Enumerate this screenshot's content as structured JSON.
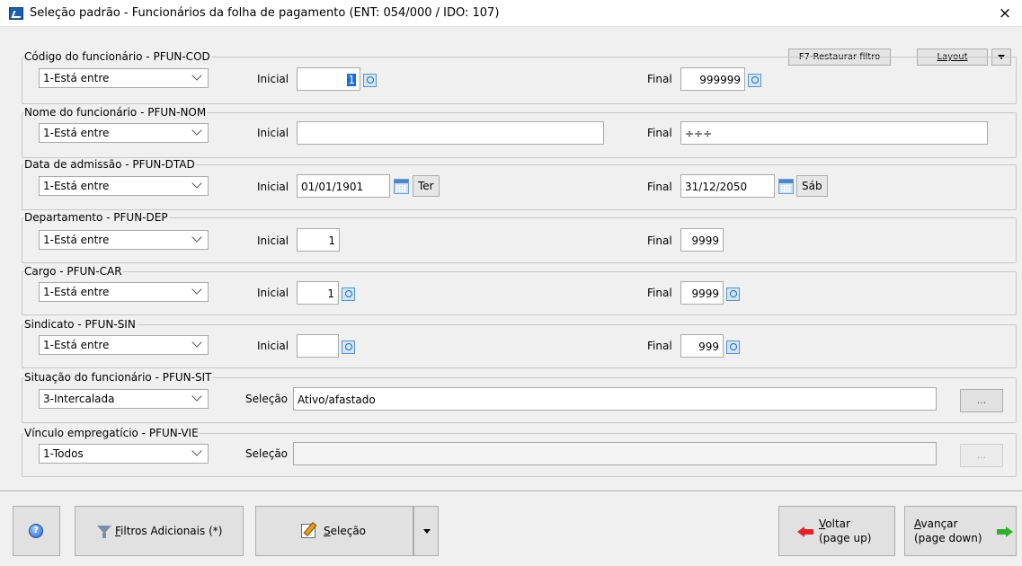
{
  "window": {
    "title": "Seleção padrão - Funcionários da folha de pagamento (ENT: 054/000 / IDO: 107)",
    "close": "×"
  },
  "toolbar": {
    "restore_filter": "F7-Restaurar filtro",
    "layout": "Layout"
  },
  "labels": {
    "initial": "Inicial",
    "final": "Final",
    "selection": "Seleção"
  },
  "groups": [
    {
      "title": "Código do funcionário - PFUN-COD",
      "operator": "1-Está entre",
      "initial": "1",
      "final": "999999"
    },
    {
      "title": "Nome do funcionário - PFUN-NOM",
      "operator": "1-Está entre",
      "initial": "",
      "final": "÷÷÷"
    },
    {
      "title": "Data de admissão - PFUN-DTAD",
      "operator": "1-Está entre",
      "initial": "01/01/1901",
      "initial_day": "Ter",
      "final": "31/12/2050",
      "final_day": "Sáb"
    },
    {
      "title": "Departamento - PFUN-DEP",
      "operator": "1-Está entre",
      "initial": "1",
      "final": "9999"
    },
    {
      "title": "Cargo - PFUN-CAR",
      "operator": "1-Está entre",
      "initial": "1",
      "final": "9999"
    },
    {
      "title": "Sindicato - PFUN-SIN",
      "operator": "1-Está entre",
      "initial": "",
      "final": "999"
    },
    {
      "title": "Situação do funcionário - PFUN-SIT",
      "operator": "3-Intercalada",
      "selection": "Ativo/afastado",
      "ellipsis": "..."
    },
    {
      "title": "Vínculo empregatício - PFUN-VIE",
      "operator": "1-Todos",
      "selection": "",
      "ellipsis": "..."
    }
  ],
  "footer": {
    "help": "?",
    "filters": "Filtros Adicionais (*)",
    "selection": "Seleção",
    "back_line1": "Voltar",
    "back_line2": "(page up)",
    "next_line1": "Avançar",
    "next_line2": "(page down)"
  }
}
